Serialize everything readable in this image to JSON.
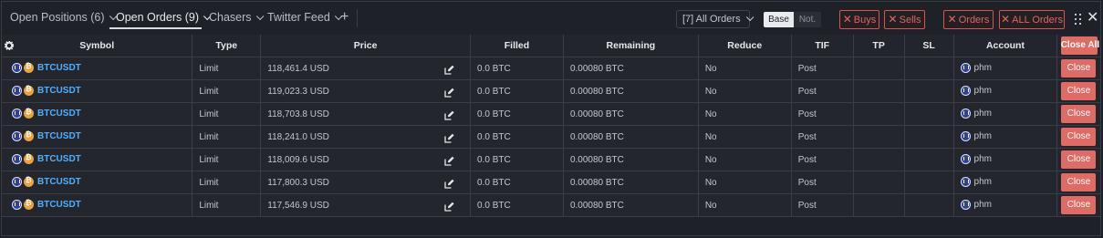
{
  "tabs": [
    {
      "label": "Open Positions (6)",
      "has_dropdown": true
    },
    {
      "label": "Open Orders (9)",
      "has_dropdown": true,
      "active": true
    },
    {
      "label": "Chasers",
      "has_dropdown": true
    },
    {
      "label": "Twitter Feed",
      "has_dropdown": true
    }
  ],
  "add_tab_icon": "plus-icon",
  "orders_filter": {
    "label": "[7] All Orders"
  },
  "units_toggle": {
    "base": "Base",
    "notional": "Not.",
    "selected": "Base"
  },
  "action_buttons": {
    "buys": "Buys",
    "sells": "Sells",
    "orders": "Orders",
    "all_orders": "ALL Orders"
  },
  "columns": [
    "Symbol",
    "Type",
    "Price",
    "Filled",
    "Remaining",
    "Reduce",
    "TIF",
    "TP",
    "SL",
    "Account"
  ],
  "close_all_label": "Close All",
  "close_label": "Close",
  "rows": [
    {
      "symbol": "BTCUSDT",
      "type": "Limit",
      "price": "118,461.4 USD",
      "filled": "0.0 BTC",
      "remaining": "0.00080 BTC",
      "reduce": "No",
      "tif": "Post",
      "tp": "",
      "sl": "",
      "account": "phm"
    },
    {
      "symbol": "BTCUSDT",
      "type": "Limit",
      "price": "119,023.3 USD",
      "filled": "0.0 BTC",
      "remaining": "0.00080 BTC",
      "reduce": "No",
      "tif": "Post",
      "tp": "",
      "sl": "",
      "account": "phm"
    },
    {
      "symbol": "BTCUSDT",
      "type": "Limit",
      "price": "118,703.8 USD",
      "filled": "0.0 BTC",
      "remaining": "0.00080 BTC",
      "reduce": "No",
      "tif": "Post",
      "tp": "",
      "sl": "",
      "account": "phm"
    },
    {
      "symbol": "BTCUSDT",
      "type": "Limit",
      "price": "118,241.0 USD",
      "filled": "0.0 BTC",
      "remaining": "0.00080 BTC",
      "reduce": "No",
      "tif": "Post",
      "tp": "",
      "sl": "",
      "account": "phm"
    },
    {
      "symbol": "BTCUSDT",
      "type": "Limit",
      "price": "118,009.6 USD",
      "filled": "0.0 BTC",
      "remaining": "0.00080 BTC",
      "reduce": "No",
      "tif": "Post",
      "tp": "",
      "sl": "",
      "account": "phm"
    },
    {
      "symbol": "BTCUSDT",
      "type": "Limit",
      "price": "117,800.3 USD",
      "filled": "0.0 BTC",
      "remaining": "0.00080 BTC",
      "reduce": "No",
      "tif": "Post",
      "tp": "",
      "sl": "",
      "account": "phm"
    },
    {
      "symbol": "BTCUSDT",
      "type": "Limit",
      "price": "117,546.9 USD",
      "filled": "0.0 BTC",
      "remaining": "0.00080 BTC",
      "reduce": "No",
      "tif": "Post",
      "tp": "",
      "sl": "",
      "account": "phm"
    }
  ],
  "colors": {
    "accent_red": "#e06a64",
    "symbol_blue": "#4fb0ff",
    "background": "#1f2128"
  }
}
